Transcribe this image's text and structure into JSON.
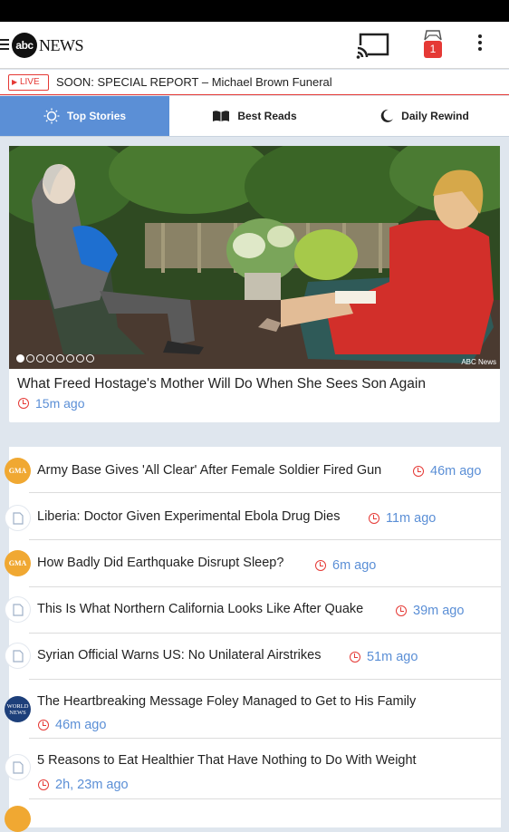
{
  "app": {
    "logo_mark": "abc",
    "logo_text": "NEWS",
    "notification_count": "1",
    "icons": {
      "menu": "menu-icon",
      "cast": "cast-icon",
      "notifications": "inbox-icon",
      "overflow": "overflow-icon"
    }
  },
  "ticker": {
    "badge": "LIVE",
    "text": "SOON: SPECIAL REPORT – Michael Brown Funeral"
  },
  "tabs": [
    {
      "label": "Top Stories",
      "icon": "sun-icon",
      "active": true
    },
    {
      "label": "Best Reads",
      "icon": "book-icon",
      "active": false
    },
    {
      "label": "Daily Rewind",
      "icon": "moon-icon",
      "active": false
    }
  ],
  "hero": {
    "title": "What Freed Hostage's Mother Will Do When She Sees Son Again",
    "time": "15m ago",
    "credit": "ABC News",
    "slide_index": 1,
    "slide_count": 8
  },
  "stories": [
    {
      "title": "Army Base Gives 'All Clear' After Female Soldier Fired Gun",
      "time": "46m ago",
      "source": "gma-icon",
      "source_label": "GMA"
    },
    {
      "title": "Liberia: Doctor Given Experimental Ebola Drug Dies",
      "time": "11m ago",
      "source": "document-icon"
    },
    {
      "title": "How Badly Did Earthquake Disrupt Sleep?",
      "time": "6m ago",
      "source": "gma-icon",
      "source_label": "GMA"
    },
    {
      "title": "This Is What Northern California Looks Like After Quake",
      "time": "39m ago",
      "source": "document-icon"
    },
    {
      "title": "Syrian Official Warns US: No Unilateral Airstrikes",
      "time": "51m ago",
      "source": "document-icon"
    },
    {
      "title": "The Heartbreaking Message Foley Managed to Get to His Family",
      "time": "46m ago",
      "source": "world-news-icon",
      "source_label": "WORLD NEWS"
    },
    {
      "title": "5 Reasons to Eat Healthier That Have Nothing to Do With Weight",
      "time": "2h, 23m ago",
      "source": "document-icon"
    }
  ],
  "colors": {
    "accent": "#5b8fd6",
    "live_red": "#e53935",
    "background": "#dfe6ee"
  }
}
